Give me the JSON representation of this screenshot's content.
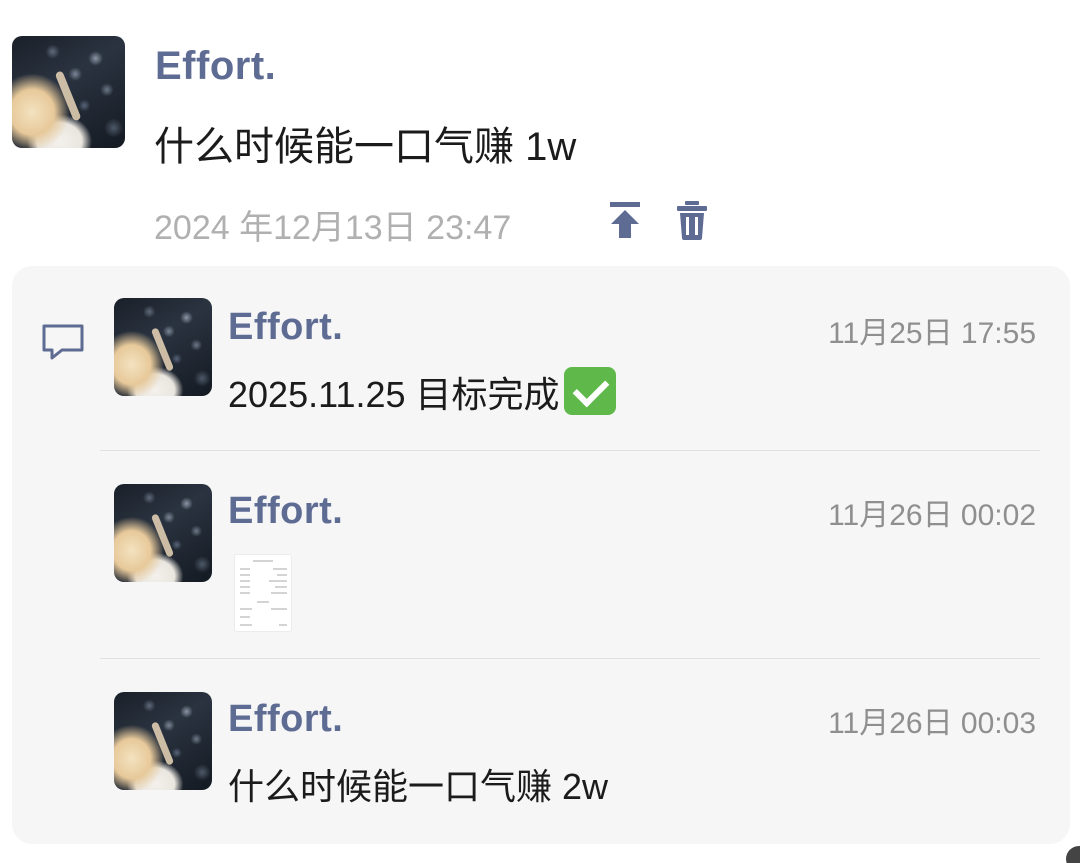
{
  "post": {
    "author": "Effort.",
    "text": "什么时候能一口气赚 1w",
    "time": "2024 年12月13日 23:47",
    "actions": {
      "pin_icon": "pin-to-top-icon",
      "delete_icon": "trash-icon"
    }
  },
  "comments": {
    "icon": "comment-bubble-icon",
    "items": [
      {
        "author": "Effort.",
        "time": "11月25日 17:55",
        "text": "2025.11.25 目标完成",
        "emoji": "check-mark-emoji"
      },
      {
        "author": "Effort.",
        "time": "11月26日 00:02",
        "attachment": "image-thumbnail"
      },
      {
        "author": "Effort.",
        "time": "11月26日 00:03",
        "text": "什么时候能一口气赚 2w"
      }
    ]
  },
  "colors": {
    "name": "#5e6b93",
    "text": "#1b1b1b",
    "timestamp": "#b0b0b0",
    "panel_bg": "#f6f6f6",
    "icon": "#5e6b93",
    "check_bg": "#5fb84a"
  }
}
